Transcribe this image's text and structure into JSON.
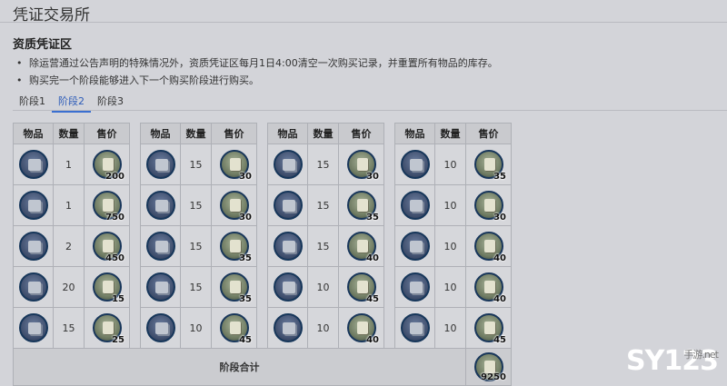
{
  "page": {
    "title": "凭证交易所",
    "section_title": "资质凭证区",
    "notes": [
      "除运营通过公告声明的特殊情况外，资质凭证区每月1日4:00清空一次购买记录，并重置所有物品的库存。",
      "购买完一个阶段能够进入下一个购买阶段进行购买。"
    ]
  },
  "tabs": [
    {
      "label": "阶段1",
      "active": false
    },
    {
      "label": "阶段2",
      "active": true
    },
    {
      "label": "阶段3",
      "active": false
    }
  ],
  "table": {
    "headers": {
      "item": "物品",
      "qty": "数量",
      "price": "售价"
    },
    "columns": [
      {
        "rows": [
          {
            "qty": "1",
            "price": "200"
          },
          {
            "qty": "1",
            "price": "750"
          },
          {
            "qty": "2",
            "price": "450"
          },
          {
            "qty": "20",
            "price": "15"
          },
          {
            "qty": "15",
            "price": "25"
          }
        ]
      },
      {
        "rows": [
          {
            "qty": "15",
            "price": "30"
          },
          {
            "qty": "15",
            "price": "30"
          },
          {
            "qty": "15",
            "price": "35"
          },
          {
            "qty": "15",
            "price": "35"
          },
          {
            "qty": "10",
            "price": "45"
          }
        ]
      },
      {
        "rows": [
          {
            "qty": "15",
            "price": "30"
          },
          {
            "qty": "15",
            "price": "35"
          },
          {
            "qty": "15",
            "price": "40"
          },
          {
            "qty": "10",
            "price": "45"
          },
          {
            "qty": "10",
            "price": "40"
          }
        ]
      },
      {
        "rows": [
          {
            "qty": "10",
            "price": "35"
          },
          {
            "qty": "10",
            "price": "30"
          },
          {
            "qty": "10",
            "price": "40"
          },
          {
            "qty": "10",
            "price": "40"
          },
          {
            "qty": "10",
            "price": "45"
          }
        ]
      }
    ],
    "total_label": "阶段合计",
    "total_price": "9250"
  },
  "watermark": {
    "logo": "SY123",
    "sub": "手游.net"
  }
}
